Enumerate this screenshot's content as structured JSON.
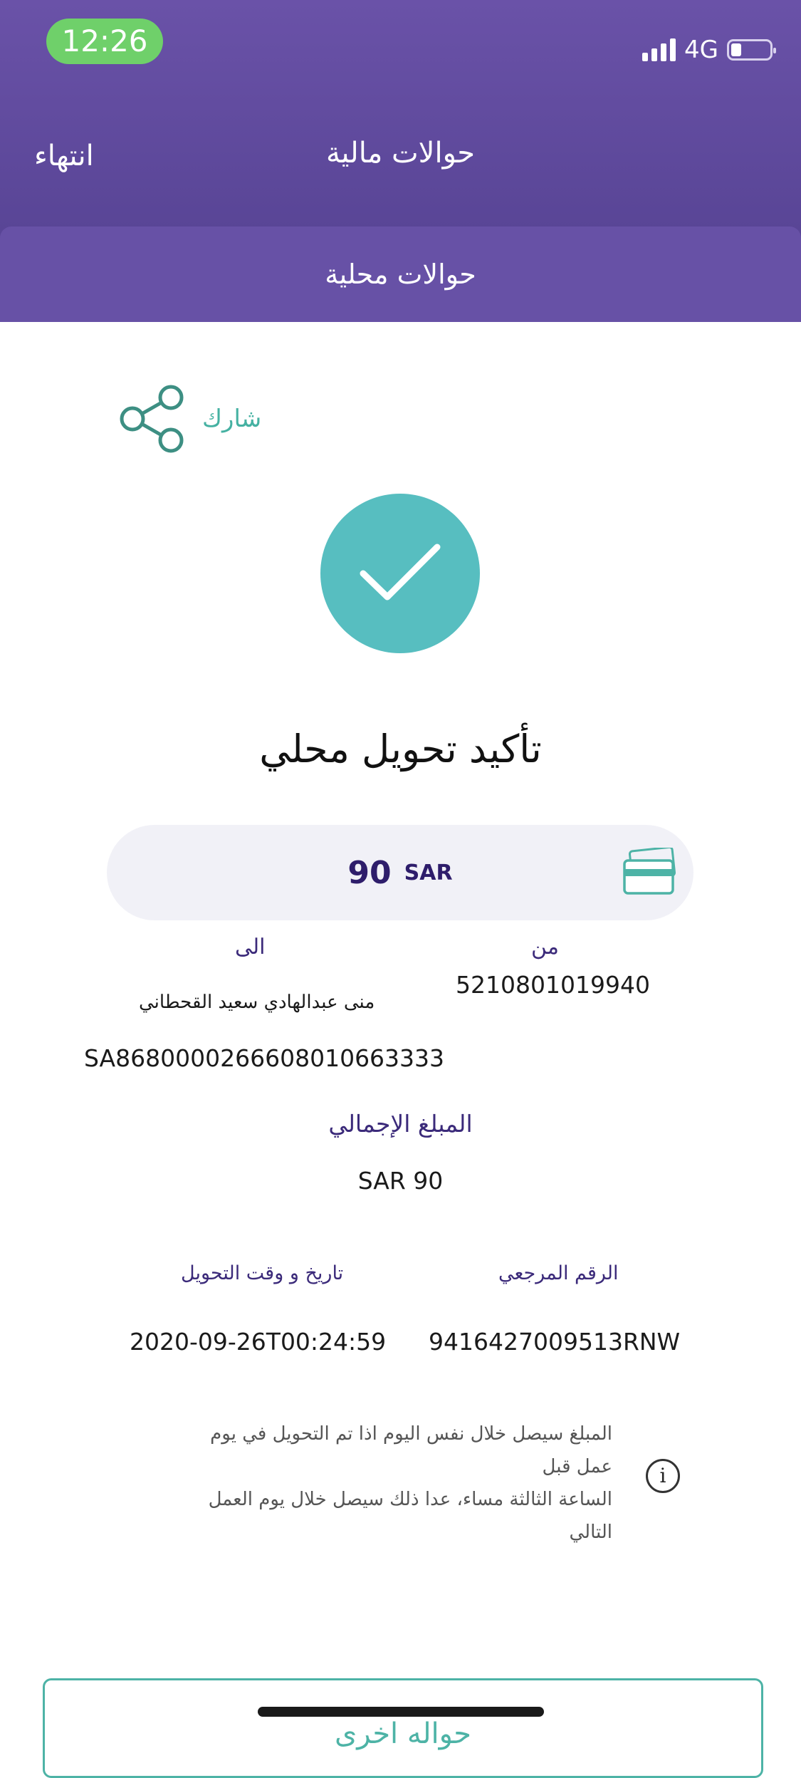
{
  "status_bar": {
    "time": "12:26",
    "network": "4G"
  },
  "nav": {
    "title": "حوالات مالية",
    "finish_label": "انتهاء"
  },
  "sub_header": {
    "title": "حوالات محلية"
  },
  "share": {
    "label": "شارك",
    "icon": "share-icon"
  },
  "confirmation": {
    "icon": "checkmark-icon",
    "title": "تأكيد تحويل محلي"
  },
  "amount": {
    "value": "90",
    "currency": "SAR",
    "icon": "card-icon"
  },
  "from": {
    "label": "من",
    "account": "5210801019940"
  },
  "to": {
    "label": "الى",
    "name": "منى عبدالهادي سعيد القحطاني",
    "iban": "SA8680000266608010663333"
  },
  "total": {
    "label": "المبلغ الإجمالي",
    "value": "SAR 90"
  },
  "reference": {
    "label": "الرقم المرجعي",
    "value": "9416427009513RNW"
  },
  "datetime": {
    "label": "تاريخ و وقت التحويل",
    "value": "2020-09-26T00:24:59"
  },
  "note": {
    "line1": "المبلغ سيصل خلال نفس اليوم اذا تم التحويل في يوم عمل قبل",
    "line2": "الساعة الثالثة مساء، عدا ذلك سيصل خلال يوم العمل التالي",
    "icon": "info-icon"
  },
  "actions": {
    "another_transfer_label": "حواله اخرى"
  },
  "colors": {
    "header": "#5e4a9e",
    "accent": "#57bec0",
    "label": "#3b2a7a"
  }
}
